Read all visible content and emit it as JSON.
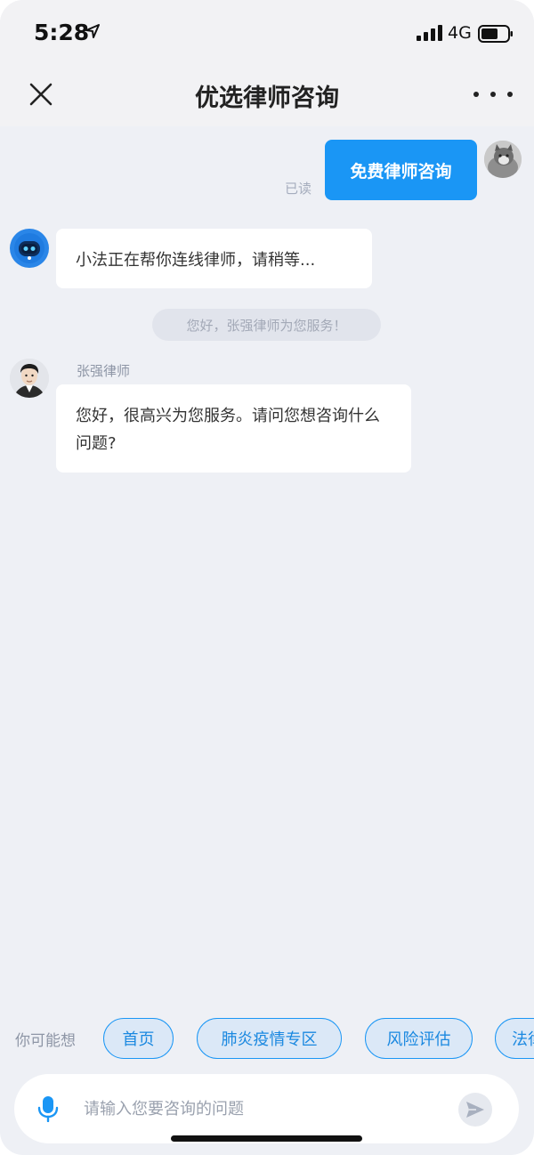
{
  "status_bar": {
    "time": "5:28",
    "network": "4G"
  },
  "header": {
    "title": "优选律师咨询"
  },
  "messages": {
    "user_message": "免费律师咨询",
    "read_status": "已读",
    "bot_message": "小法正在帮你连线律师，请稍等...",
    "system_notice": "您好，张强律师为您服务！",
    "lawyer_name": "张强律师",
    "lawyer_message": "您好，很高兴为您服务。请问您想咨询什么问题?"
  },
  "suggestions": {
    "label": "你可能想",
    "chips": [
      "首页",
      "肺炎疫情专区",
      "风险评估",
      "法律"
    ]
  },
  "input": {
    "placeholder": "请输入您要咨询的问题",
    "value": ""
  },
  "icons": {
    "close": "close-icon",
    "more": "more-icon",
    "mic": "mic-icon",
    "send": "send-icon",
    "location": "location-arrow-icon",
    "signal": "signal-icon",
    "battery": "battery-icon"
  },
  "colors": {
    "accent": "#1a96f5",
    "background": "#eef0f5",
    "chip_bg": "#dbe8f7"
  }
}
